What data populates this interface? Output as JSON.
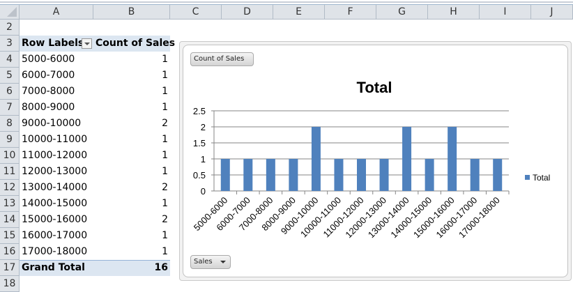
{
  "columns": [
    "A",
    "B",
    "C",
    "D",
    "E",
    "F",
    "G",
    "H",
    "I",
    "J"
  ],
  "rows": [
    "2",
    "3",
    "4",
    "5",
    "6",
    "7",
    "8",
    "9",
    "10",
    "11",
    "12",
    "13",
    "14",
    "15",
    "16",
    "17",
    "18"
  ],
  "pivot": {
    "header_row_labels": "Row Labels",
    "header_count": "Count of Sales",
    "items": [
      {
        "label": "5000-6000",
        "count": "1"
      },
      {
        "label": "6000-7000",
        "count": "1"
      },
      {
        "label": "7000-8000",
        "count": "1"
      },
      {
        "label": "8000-9000",
        "count": "1"
      },
      {
        "label": "9000-10000",
        "count": "2"
      },
      {
        "label": "10000-11000",
        "count": "1"
      },
      {
        "label": "11000-12000",
        "count": "1"
      },
      {
        "label": "12000-13000",
        "count": "1"
      },
      {
        "label": "13000-14000",
        "count": "2"
      },
      {
        "label": "14000-15000",
        "count": "1"
      },
      {
        "label": "15000-16000",
        "count": "2"
      },
      {
        "label": "16000-17000",
        "count": "1"
      },
      {
        "label": "17000-18000",
        "count": "1"
      }
    ],
    "grand_total_label": "Grand Total",
    "grand_total": "16"
  },
  "chart": {
    "value_field_button": "Count of Sales",
    "axis_field_button": "Sales",
    "bar_color": "#4f81bd"
  },
  "chart_data": {
    "type": "bar",
    "title": "Total",
    "categories": [
      "5000-6000",
      "6000-7000",
      "7000-8000",
      "8000-9000",
      "9000-10000",
      "10000-11000",
      "11000-12000",
      "12000-13000",
      "13000-14000",
      "14000-15000",
      "15000-16000",
      "16000-17000",
      "17000-18000"
    ],
    "series": [
      {
        "name": "Total",
        "values": [
          1,
          1,
          1,
          1,
          2,
          1,
          1,
          1,
          2,
          1,
          2,
          1,
          1
        ]
      }
    ],
    "ylim": [
      0,
      2.5
    ],
    "yticks": [
      "0",
      "0.5",
      "1",
      "1.5",
      "2",
      "2.5"
    ],
    "grid": true,
    "legend": "right"
  }
}
